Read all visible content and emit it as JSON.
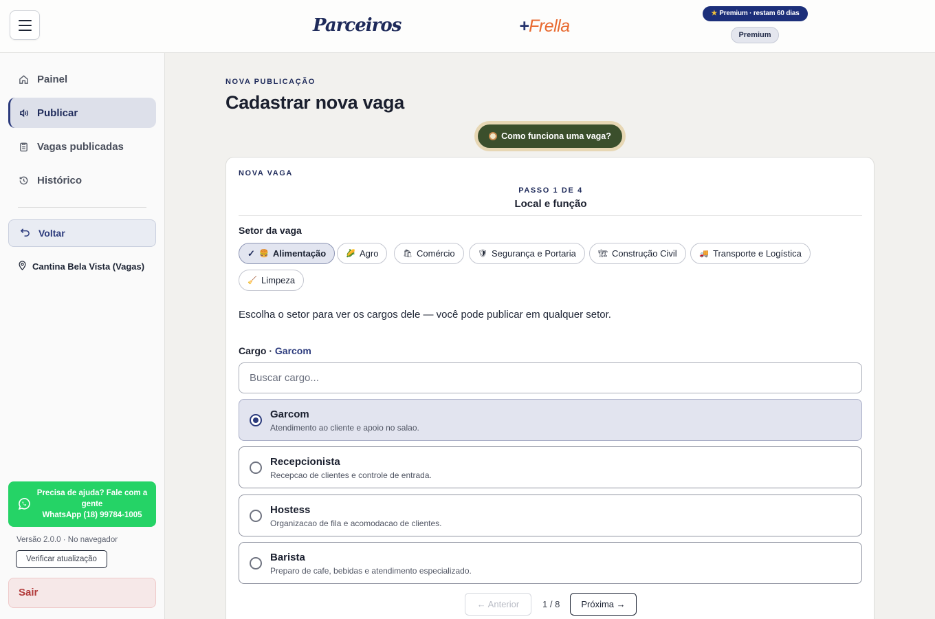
{
  "header": {
    "logo_parceiros": "Parceiros",
    "logo_frella_plus": "+",
    "logo_frella_name": "Frella",
    "premium_badge": "Premium · restam 60 dias",
    "premium_pill": "Premium"
  },
  "sidebar": {
    "items": [
      {
        "label": "Painel",
        "icon": "home-icon"
      },
      {
        "label": "Publicar",
        "icon": "megaphone-icon",
        "active": true
      },
      {
        "label": "Vagas publicadas",
        "icon": "clipboard-icon"
      },
      {
        "label": "Histórico",
        "icon": "history-icon"
      }
    ],
    "back_label": "Voltar",
    "location": "Cantina Bela Vista (Vagas)",
    "help_text": "Precisa de ajuda? Fale com a gente",
    "help_phone": "WhatsApp (18) 99784-1005",
    "version": "Versão 2.0.0 · No navegador",
    "update_label": "Verificar atualização",
    "logout_label": "Sair"
  },
  "main": {
    "eyebrow": "NOVA PUBLICAÇÃO",
    "title": "Cadastrar nova vaga",
    "how_label": "Como funciona uma vaga?",
    "card": {
      "eyebrow": "NOVA VAGA",
      "step": "PASSO 1 DE 4",
      "step_title": "Local e função",
      "setor_label": "Setor da vaga",
      "sectors": [
        {
          "label": "Alimentação",
          "emoji": "🍔",
          "active": true
        },
        {
          "label": "Agro",
          "emoji": "🌽"
        },
        {
          "label": "Comércio",
          "emoji": "🛍"
        },
        {
          "label": "Segurança e Portaria",
          "emoji": "🛡"
        },
        {
          "label": "Construção Civil",
          "emoji": "🏗"
        },
        {
          "label": "Transporte e Logística",
          "emoji": "🚚"
        },
        {
          "label": "Limpeza",
          "emoji": "🧹"
        }
      ],
      "hint": "Escolha o setor para ver os cargos dele — você pode publicar em qualquer setor.",
      "cargo_label": "Cargo · ",
      "cargo_selected": "Garcom",
      "search_placeholder": "Buscar cargo...",
      "options": [
        {
          "name": "Garcom",
          "desc": "Atendimento ao cliente e apoio no salao.",
          "selected": true
        },
        {
          "name": "Recepcionista",
          "desc": "Recepcao de clientes e controle de entrada."
        },
        {
          "name": "Hostess",
          "desc": "Organizacao de fila e acomodacao de clientes."
        },
        {
          "name": "Barista",
          "desc": "Preparo de cafe, bebidas e atendimento especializado."
        }
      ],
      "pager": {
        "prev": "← Anterior",
        "indicator": "1 / 8",
        "next": "Próxima →"
      }
    }
  }
}
